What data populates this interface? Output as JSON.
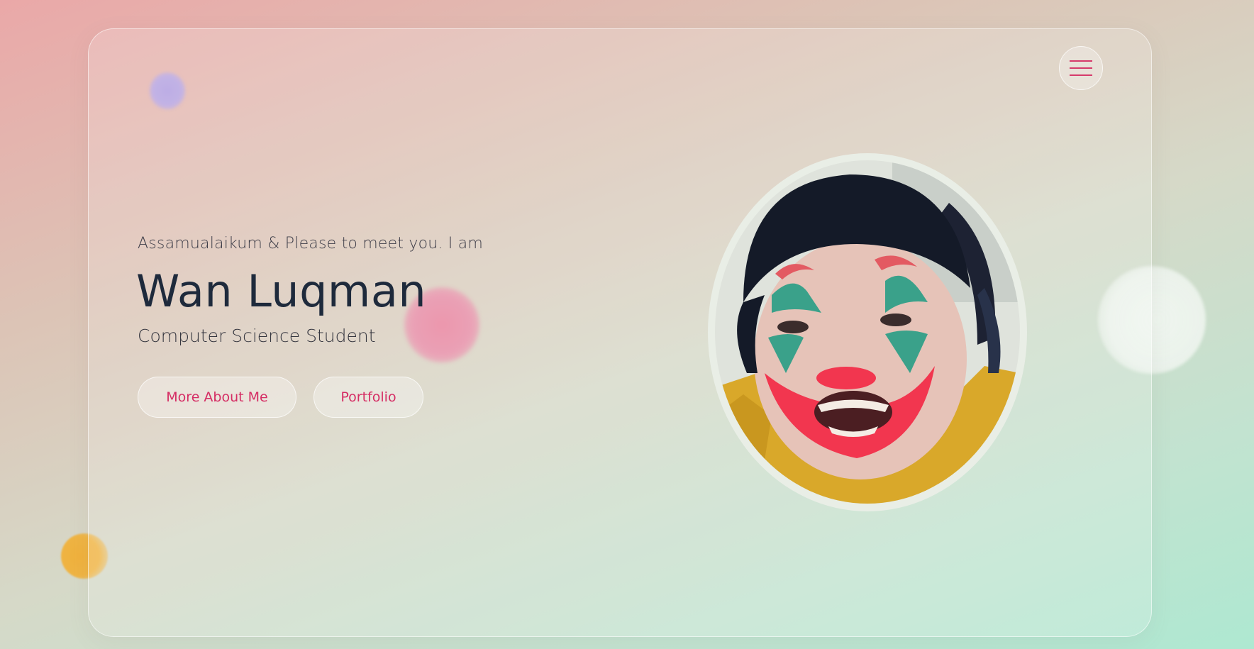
{
  "hero": {
    "greeting": "Assamualaikum & Please to meet you. I am",
    "name": "Wan Luqman",
    "role": "Computer Science Student"
  },
  "actions": {
    "about_label": "More About Me",
    "portfolio_label": "Portfolio"
  },
  "nav": {
    "menu_icon": "hamburger-menu-icon"
  },
  "colors": {
    "accent": "#d52d64",
    "heading": "#1e2a3c",
    "body_text": "#3d3d48"
  }
}
